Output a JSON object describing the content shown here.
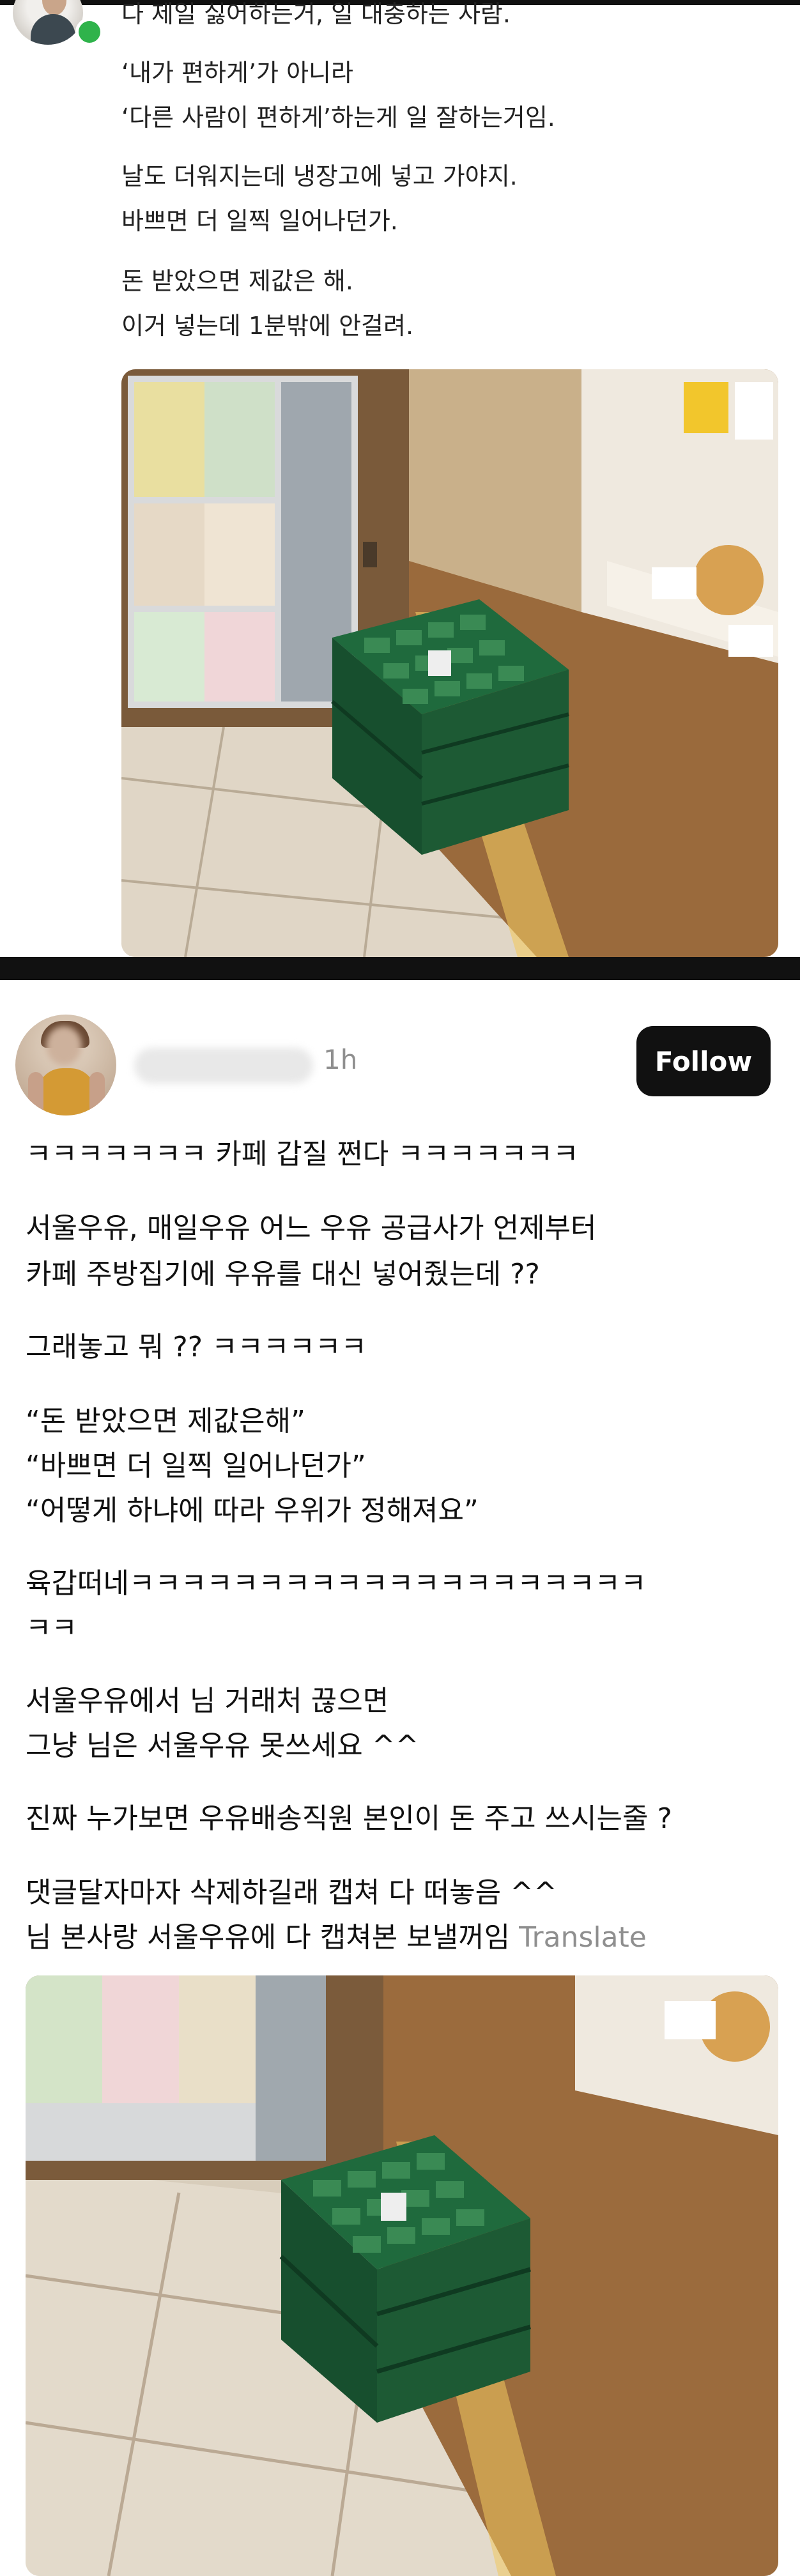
{
  "post1": {
    "lines": [
      "다 제일 싫어하는거, 일 대충하는 사람.",
      "‘내가 편하게’가 아니라",
      "‘다른 사람이 편하게’하는게 일 잘하는거임.",
      "날도 더워지는데 냉장고에 넣고 가야지.",
      "바쁘면 더 일찍 일어나던가.",
      "돈 받았으면 제값은 해.",
      "이거 넣는데 1분밖에 안걸려."
    ]
  },
  "post2": {
    "time": "1h",
    "follow_label": "Follow",
    "lines": [
      "ㅋㅋㅋㅋㅋㅋㅋ 카페 갑질 쩐다 ㅋㅋㅋㅋㅋㅋㅋ",
      "서울우유, 매일우유 어느 우유 공급사가 언제부터",
      "카페 주방집기에 우유를 대신 넣어줬는데 ??",
      "그래놓고 뭐 ?? ㅋㅋㅋㅋㅋㅋ",
      "“돈 받았으면 제값은해”",
      "“바쁘면 더 일찍 일어나던가”",
      "“어떻게 하냐에 따라 우위가 정해져요”",
      "육갑떠네ㅋㅋㅋㅋㅋㅋㅋㅋㅋㅋㅋㅋㅋㅋㅋㅋㅋㅋㅋㅋ",
      "ㅋㅋ",
      "서울우유에서 님 거래처 끊으면",
      "그냥 님은 서울우유 못쓰세요 ^^",
      "진짜 누가보면 우유배송직원 본인이 돈 주고 쓰시는줄 ?",
      "댓글달자마자 삭제하길래 캡쳐 다 떠놓음 ^^",
      "님 본사랑 서울우유에 다 캡쳐본 보낼꺼임"
    ],
    "translate_label": "Translate"
  },
  "colors": {
    "follow_bg": "#111111",
    "online": "#2fb34b",
    "crate": "#1d5a34",
    "muted": "#8f8f8f"
  },
  "icons": [
    "online-status-icon"
  ]
}
